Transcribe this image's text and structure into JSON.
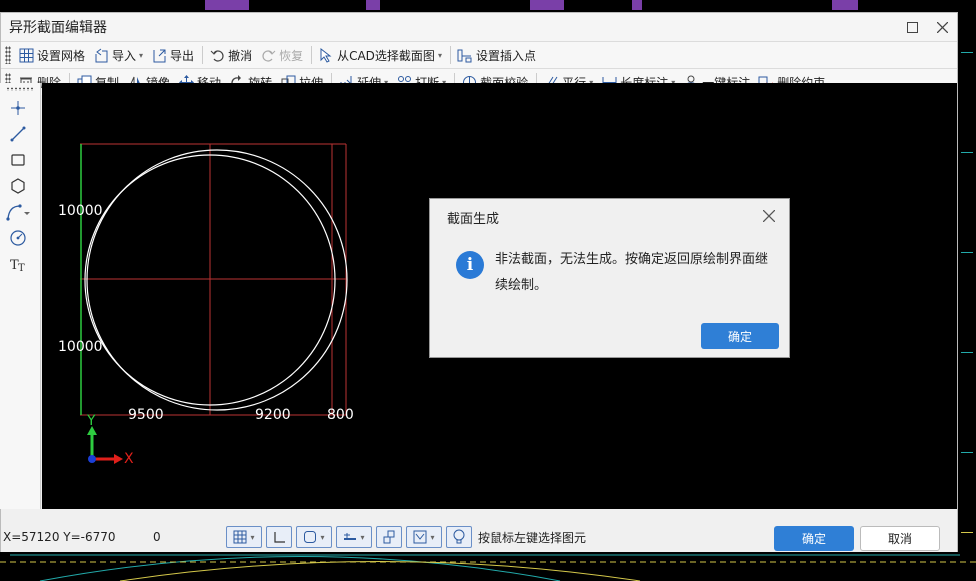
{
  "window": {
    "title": "异形截面编辑器",
    "maximize_icon": "maximize-icon",
    "close_icon": "close-icon"
  },
  "toolbar1": [
    {
      "id": "set-grid",
      "label": "设置网格",
      "icon": "grid-icon",
      "dropdown": false,
      "disabled": false
    },
    {
      "id": "import",
      "label": "导入",
      "icon": "import-icon",
      "dropdown": true,
      "disabled": false
    },
    {
      "id": "export",
      "label": "导出",
      "icon": "export-icon",
      "dropdown": false,
      "disabled": false
    },
    {
      "id": "undo",
      "label": "撤消",
      "icon": "undo-icon",
      "dropdown": false,
      "disabled": false
    },
    {
      "id": "redo",
      "label": "恢复",
      "icon": "redo-icon",
      "dropdown": false,
      "disabled": true
    },
    {
      "id": "select-cad",
      "label": "从CAD选择截面图",
      "icon": "cad-select-icon",
      "dropdown": true,
      "disabled": false
    },
    {
      "id": "set-insert-point",
      "label": "设置插入点",
      "icon": "insert-point-icon",
      "dropdown": false,
      "disabled": false
    }
  ],
  "toolbar2": [
    {
      "id": "delete",
      "label": "删除",
      "icon": "trash-icon",
      "dropdown": false
    },
    {
      "id": "copy",
      "label": "复制",
      "icon": "copy-icon",
      "dropdown": false
    },
    {
      "id": "mirror",
      "label": "镜像",
      "icon": "mirror-icon",
      "dropdown": false
    },
    {
      "id": "move",
      "label": "移动",
      "icon": "move-icon",
      "dropdown": false
    },
    {
      "id": "rotate",
      "label": "旋转",
      "icon": "rotate-icon",
      "dropdown": false
    },
    {
      "id": "stretch",
      "label": "拉伸",
      "icon": "stretch-icon",
      "dropdown": false
    },
    {
      "id": "extend",
      "label": "延伸",
      "icon": "extend-icon",
      "dropdown": true
    },
    {
      "id": "break",
      "label": "打断",
      "icon": "break-icon",
      "dropdown": true
    },
    {
      "id": "section-check",
      "label": "截面校验",
      "icon": "section-check-icon",
      "dropdown": false
    },
    {
      "id": "parallel",
      "label": "平行",
      "icon": "parallel-icon",
      "dropdown": true
    },
    {
      "id": "length-dim",
      "label": "长度标注",
      "icon": "length-dim-icon",
      "dropdown": true
    },
    {
      "id": "auto-dim",
      "label": "一键标注",
      "icon": "auto-dim-icon",
      "dropdown": false
    },
    {
      "id": "delete-constraint",
      "label": "删除约束",
      "icon": "delete-constraint-icon",
      "dropdown": false
    }
  ],
  "left_tools": [
    "point-icon",
    "line-icon",
    "rectangle-icon",
    "hexagon-icon",
    "arc-icon",
    "circle-icon",
    "text-icon"
  ],
  "canvas": {
    "dims": {
      "left_top": "10000",
      "left_bottom": "10000",
      "bottom_left": "9500",
      "bottom_mid": "9200",
      "bottom_right": "800"
    },
    "axis_y": "Y",
    "axis_x": "X"
  },
  "dialog": {
    "title": "截面生成",
    "message": "非法截面，无法生成。按确定返回原绘制界面继续绘制。",
    "ok_label": "确定",
    "icon": "info-icon"
  },
  "statusbar": {
    "coords": "X=57120 Y=-6770",
    "value": "0",
    "hint": "按鼠标左键选择图元",
    "ok_label": "确定",
    "cancel_label": "取消",
    "buttons": [
      "grid-snap-icon",
      "ortho-icon",
      "object-snap-icon",
      "polar-icon",
      "track-icon",
      "dynamic-input-icon",
      "lightbulb-icon"
    ]
  },
  "colors": {
    "accent": "#2f7fd6",
    "canvas_bg": "#000000",
    "shape_stroke": "#ffffff",
    "guide_red": "#c0392b",
    "axis_green": "#2ecc40",
    "axis_red": "#e0201b"
  }
}
